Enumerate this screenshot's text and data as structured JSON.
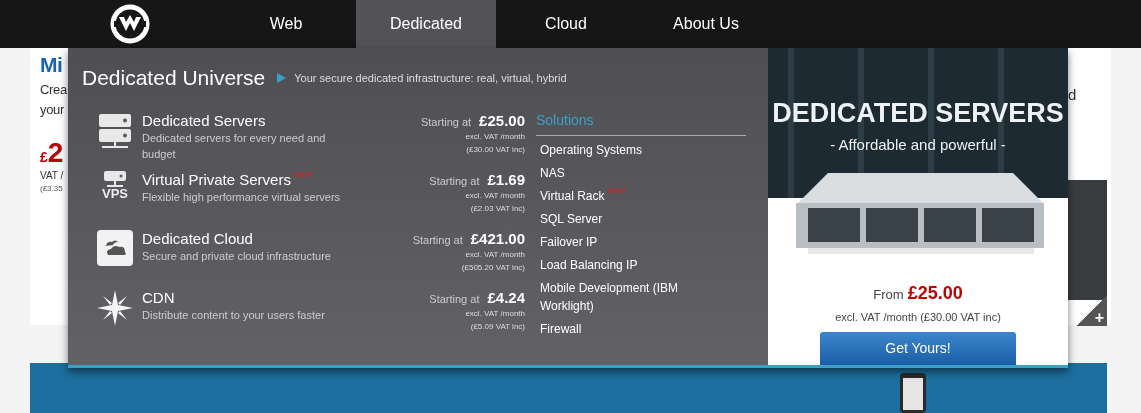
{
  "nav": {
    "tabs": [
      {
        "label": "Web",
        "selected": false
      },
      {
        "label": "Dedicated",
        "selected": true
      },
      {
        "label": "Cloud",
        "selected": false
      },
      {
        "label": "About Us",
        "selected": false
      }
    ]
  },
  "background": {
    "heading": "Mi",
    "lines": [
      "Crea",
      "your"
    ],
    "price_symbol": "£",
    "price_digit": "2",
    "vat": "VAT /",
    "vat_inc": "(£3.35",
    "right_fragment": "d",
    "expand": "+"
  },
  "menu": {
    "title": "Dedicated Universe",
    "subtitle": "Your secure dedicated infrastructure: real, virtual, hybrid",
    "products": [
      {
        "kind": "servers",
        "name": "Dedicated Servers",
        "description": "Dedicated servers for every need and budget",
        "starting": "Starting at",
        "price": "£25.00",
        "excl": "excl. VAT /month",
        "inc": "(£30.00 VAT inc)"
      },
      {
        "kind": "vps",
        "name": "Virtual Private Servers",
        "badge": "NEW",
        "icon_text": "VPS",
        "description": "Flexible high performance virtual servers",
        "starting": "Starting at",
        "price": "£1.69",
        "excl": "excl. VAT /month",
        "inc": "(£2.03 VAT inc)"
      },
      {
        "kind": "cloud",
        "name": "Dedicated Cloud",
        "description": "Secure and private cloud infrastructure",
        "starting": "Starting at",
        "price": "£421.00",
        "excl": "excl. VAT /month",
        "inc": "(£505.20 VAT inc)"
      },
      {
        "kind": "cdn",
        "name": "CDN",
        "description": "Distribute content to your users faster",
        "starting": "Starting at",
        "price": "£4.24",
        "excl": "excl. VAT /month",
        "inc": "(£5.09 VAT inc)"
      }
    ],
    "solutions": {
      "title": "Solutions",
      "items": [
        {
          "label": "Operating Systems"
        },
        {
          "label": "NAS"
        },
        {
          "label": "Virtual Rack",
          "badge": "NEW"
        },
        {
          "label": "SQL Server"
        },
        {
          "label": "Failover IP"
        },
        {
          "label": "Load Balancing IP"
        },
        {
          "label": "Mobile Development (IBM Worklight)"
        },
        {
          "label": "Firewall"
        }
      ]
    },
    "promo": {
      "title": "DEDICATED SERVERS",
      "tagline": "- Affordable and powerful -",
      "from": "From",
      "price": "£25.00",
      "note": "excl. VAT /month (£30.00 VAT inc)",
      "button": "Get Yours!"
    }
  }
}
